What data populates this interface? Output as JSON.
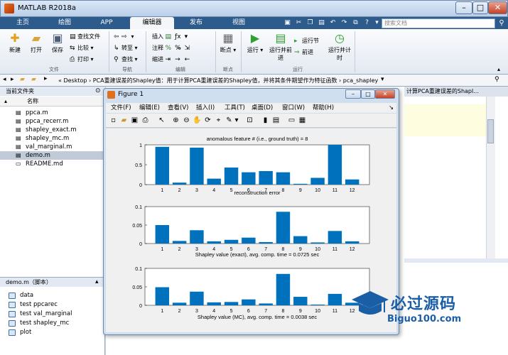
{
  "window": {
    "title": "MATLAB R2018a"
  },
  "tabs": [
    "主页",
    "绘图",
    "APP",
    "编辑器",
    "发布",
    "视图"
  ],
  "search": {
    "placeholder": "搜索文档"
  },
  "ribbon": {
    "new": "新建",
    "open": "打开",
    "save": "保存",
    "find_files": "查找文件",
    "compare": "比较",
    "print": "打印",
    "goto": "转至",
    "find": "查找",
    "insert": "插入",
    "comment": "注释",
    "indent": "缩进",
    "breakpoints": "断点",
    "run": "运行",
    "run_advance": "运行并前进",
    "run_section": "运行节",
    "advance": "前进",
    "run_time": "运行并计时",
    "groups": {
      "file": "文件",
      "nav": "导航",
      "edit": "编辑",
      "breakpoints": "断点",
      "run": "运行"
    }
  },
  "address": {
    "path": "« Desktop › PCA重建误差的Shapley值：用于计算PCA重建误差的Shapley值，并将其条件期望作为特征函数 › pca_shapley-master"
  },
  "current_folder": {
    "title": "当前文件夹",
    "column": "名称",
    "files": [
      "ppca.m",
      "ppca_recerr.m",
      "shapley_exact.m",
      "shapley_mc.m",
      "val_marginal.m",
      "demo.m",
      "README.md"
    ]
  },
  "details": {
    "title": "demo.m（脚本）",
    "sections": [
      "data",
      "test ppcarec",
      "test val_marginal",
      "test shapley_mc",
      "plot"
    ]
  },
  "editor": {
    "tab_label": "计算PCA重建误差的Shapl..."
  },
  "figure": {
    "title": "Figure 1",
    "menu": [
      "文件(F)",
      "编辑(E)",
      "查看(V)",
      "插入(I)",
      "工具(T)",
      "桌面(D)",
      "窗口(W)",
      "帮助(H)"
    ]
  },
  "colors": {
    "bar": "#0072BD"
  },
  "chart_data": [
    {
      "type": "bar",
      "title": "anomalous feature # (i.e., ground truth) = 8",
      "xlabel": "reconstruction error",
      "ylabel": "",
      "categories": [
        "1",
        "2",
        "3",
        "4",
        "5",
        "6",
        "7",
        "8",
        "9",
        "10",
        "11",
        "12"
      ],
      "values": [
        0.95,
        0.05,
        0.93,
        0.15,
        0.43,
        0.31,
        0.34,
        0.31,
        0.02,
        0.17,
        1.05,
        0.13
      ],
      "ylim": [
        0,
        1
      ],
      "yticks": [
        "0",
        "0.5",
        "1"
      ]
    },
    {
      "type": "bar",
      "title": "",
      "xlabel": "Shapley value (exact), avg. comp. time = 0.0725 sec",
      "ylabel": "",
      "categories": [
        "1",
        "2",
        "3",
        "4",
        "5",
        "6",
        "7",
        "8",
        "9",
        "10",
        "11",
        "12"
      ],
      "values": [
        0.05,
        0.007,
        0.036,
        0.006,
        0.01,
        0.016,
        0.004,
        0.086,
        0.02,
        0.003,
        0.034,
        0.006
      ],
      "ylim": [
        0,
        0.1
      ],
      "yticks": [
        "0",
        "0.05",
        "0.1"
      ]
    },
    {
      "type": "bar",
      "title": "",
      "xlabel": "Shapley value (MC), avg. comp. time = 0.0038 sec",
      "ylabel": "",
      "categories": [
        "1",
        "2",
        "3",
        "4",
        "5",
        "6",
        "7",
        "8",
        "9",
        "10",
        "11",
        "12"
      ],
      "values": [
        0.049,
        0.007,
        0.037,
        0.008,
        0.009,
        0.016,
        0.005,
        0.085,
        0.023,
        0.002,
        0.031,
        0.007
      ],
      "ylim": [
        0,
        0.1
      ],
      "yticks": [
        "0",
        "0.05",
        "0.1"
      ]
    }
  ],
  "watermark": {
    "text": "必过源码",
    "url": "Biguo100.com"
  }
}
